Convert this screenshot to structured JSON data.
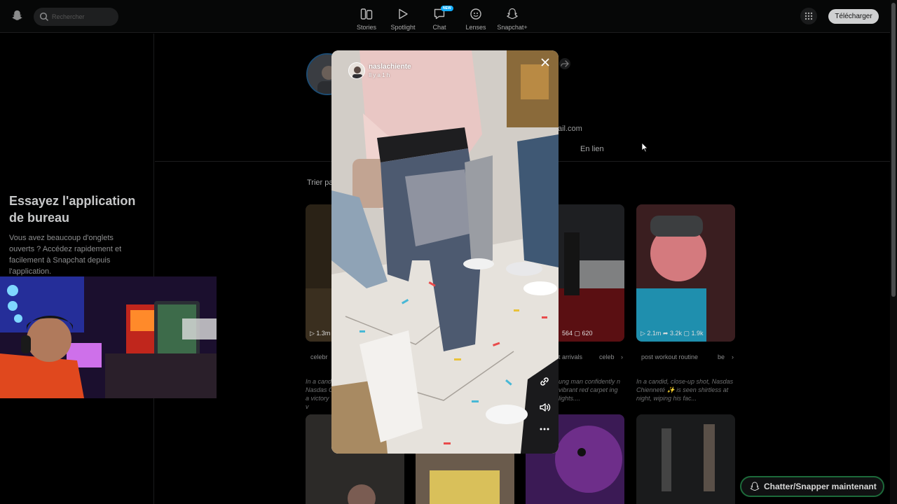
{
  "header": {
    "search_placeholder": "Rechercher",
    "nav": [
      {
        "label": "Stories",
        "icon": "stories-icon"
      },
      {
        "label": "Spotlight",
        "icon": "spotlight-play-icon"
      },
      {
        "label": "Chat",
        "icon": "chat-icon",
        "badge": "NEW"
      },
      {
        "label": "Lenses",
        "icon": "lenses-icon"
      },
      {
        "label": "Snapchat+",
        "icon": "snapchat-plus-icon"
      }
    ],
    "download_label": "Télécharger"
  },
  "sidebar": {
    "promo_title": "Essayez l'application de bureau",
    "promo_text": "Vous avez beaucoup d'onglets ouverts ? Accédez rapidement et facilement à Snapchat depuis l'application."
  },
  "profile": {
    "email_fragment": "ail.com",
    "tab_label": "En lien",
    "sort_label": "Trier pa"
  },
  "cards": [
    {
      "stats": "▷ 1.3m",
      "tag1": "celebr",
      "desc": "In a cand Nasdas C a victory v"
    },
    {
      "stats": "564  ▢ 620",
      "tag1": "t arrivals",
      "tag2": "celeb",
      "desc": "ung man confidently n vibrant red carpet ing lights...."
    },
    {
      "stats": "▷ 2.1m  ➦ 3.2k  ▢ 1.9k",
      "tag1": "post workout routine",
      "tag2": "be",
      "desc": "In a candid, close-up shot, Nasdas Chienneté ✨ is seen shirtless at night, wiping his fac..."
    }
  ],
  "viewer": {
    "username": "naslachiente",
    "time": "Il y a 1 h"
  },
  "chat_cta": "Chatter/Snapper maintenant",
  "colors": {
    "accent": "#0fadff",
    "cta_border": "#1d6a3a",
    "download_bg": "#cfd0d1"
  }
}
